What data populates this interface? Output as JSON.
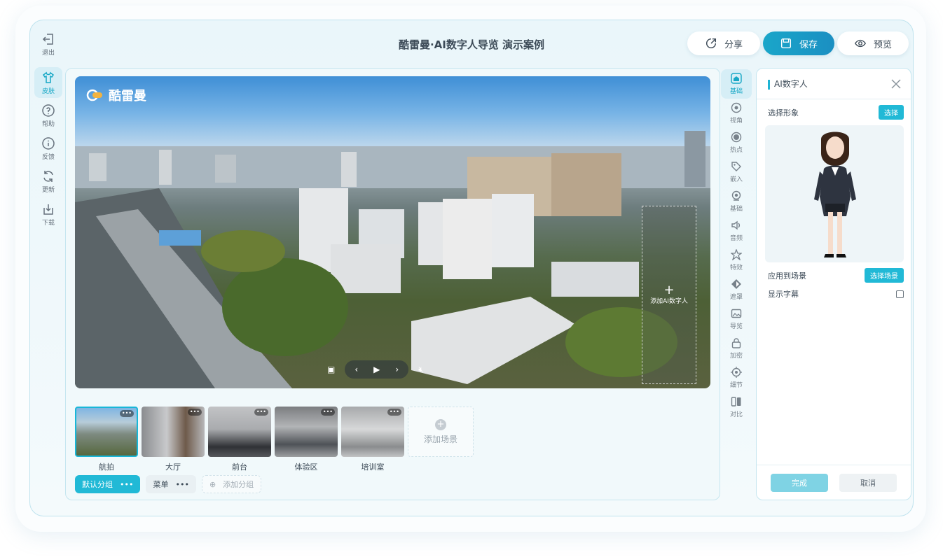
{
  "header": {
    "title": "酷雷曼·AI数字人导览 演示案例",
    "share_label": "分享",
    "save_label": "保存",
    "preview_label": "预览"
  },
  "left_nav": {
    "exit_label": "退出",
    "items": [
      {
        "label": "皮肤",
        "icon": "shirt-icon"
      },
      {
        "label": "帮助",
        "icon": "help-icon"
      },
      {
        "label": "反馈",
        "icon": "info-icon"
      },
      {
        "label": "更新",
        "icon": "refresh-icon"
      },
      {
        "label": "下载",
        "icon": "download-icon"
      }
    ]
  },
  "pano": {
    "brand": "酷雷曼",
    "add_ai_label": "添加AI数字人"
  },
  "scenes": [
    {
      "label": "航拍"
    },
    {
      "label": "大厅"
    },
    {
      "label": "前台"
    },
    {
      "label": "体验区"
    },
    {
      "label": "培训室"
    }
  ],
  "add_scene_label": "添加场景",
  "groups": {
    "default_label": "默认分组",
    "menu_label": "菜单",
    "add_label": "添加分组"
  },
  "right_tools": [
    {
      "label": "基础"
    },
    {
      "label": "视角"
    },
    {
      "label": "热点"
    },
    {
      "label": "嵌入"
    },
    {
      "label": "基础"
    },
    {
      "label": "音频"
    },
    {
      "label": "特效"
    },
    {
      "label": "遮罩"
    },
    {
      "label": "导览"
    },
    {
      "label": "加密"
    },
    {
      "label": "细节"
    },
    {
      "label": "对比"
    }
  ],
  "panel": {
    "title": "AI数字人",
    "select_image_label": "选择形象",
    "select_button": "选择",
    "apply_label": "应用到场景",
    "apply_button": "选择场景",
    "subtitle_label": "显示字幕",
    "done_button": "完成",
    "cancel_button": "取消"
  },
  "colors": {
    "accent": "#21b9d6",
    "save_gradient_start": "#1aa6c9"
  }
}
